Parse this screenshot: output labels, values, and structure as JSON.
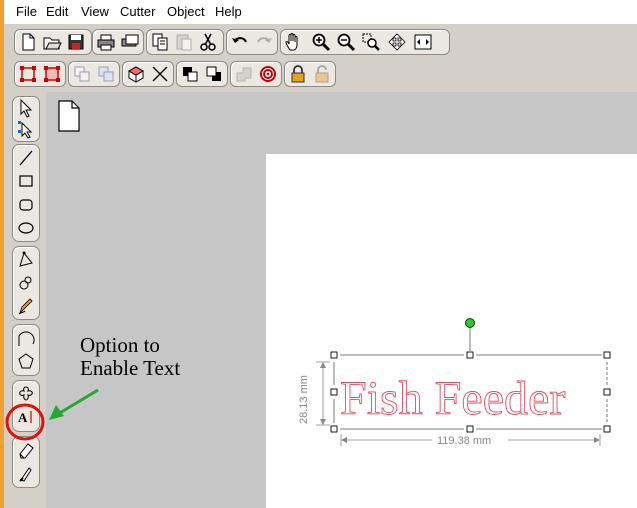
{
  "menu": {
    "file": "File",
    "edit": "Edit",
    "view": "View",
    "cutter": "Cutter",
    "object": "Object",
    "help": "Help"
  },
  "toolbar_icons": [
    "new-document-icon",
    "open-folder-icon",
    "save-icon",
    "print-icon",
    "print-preview-icon",
    "copy-icon",
    "paste-icon",
    "cut-icon",
    "undo-icon",
    "redo-icon",
    "pan-hand-icon",
    "zoom-in-icon",
    "zoom-out-icon",
    "zoom-selection-icon",
    "zoom-fit-icon",
    "zoom-page-icon",
    "align-icon",
    "distribute-icon",
    "group-icon",
    "ungroup-icon",
    "3d-box-icon",
    "delete-cross-icon",
    "bring-front-icon",
    "send-back-icon",
    "weld-icon",
    "target-icon",
    "lock-icon",
    "unlock-icon"
  ],
  "left_tool_icons": [
    "select-arrow-icon",
    "node-edit-icon",
    "line-icon",
    "rectangle-icon",
    "rounded-rectangle-icon",
    "ellipse-icon",
    "bezier-icon",
    "spiral-icon",
    "freehand-pencil-icon",
    "arc-icon",
    "polygon-icon",
    "star-icon",
    "text-tool-icon",
    "eraser-icon",
    "knife-icon"
  ],
  "annotation": {
    "line1": "Option to",
    "line2": "Enable Text",
    "arrow_color": "#22aa33",
    "circle_color": "#e01010"
  },
  "design": {
    "text": "Fish Feeder",
    "text_color": "#e84a5f",
    "width_label": "119.38 mm",
    "height_label": "28.13 mm",
    "rotation_handle_color": "#22cc22"
  }
}
